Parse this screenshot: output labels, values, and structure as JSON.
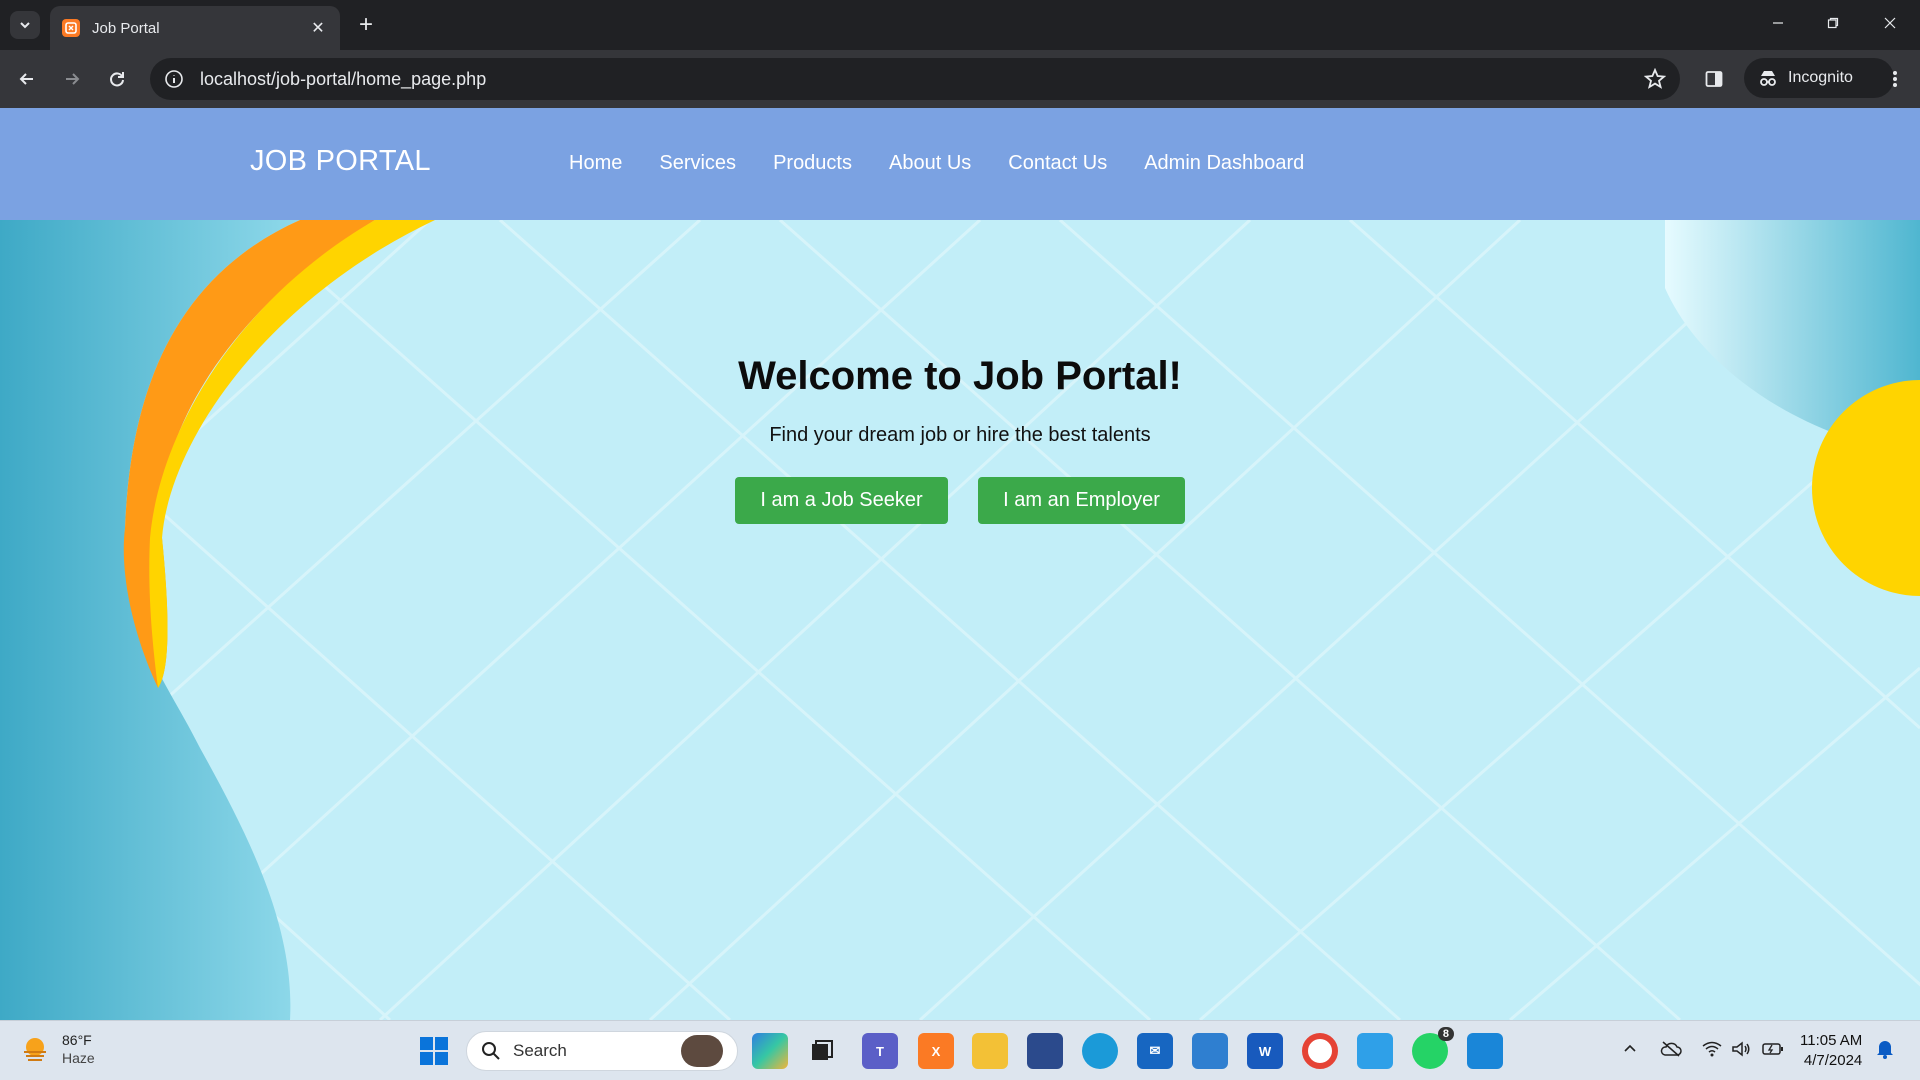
{
  "browser": {
    "tab_title": "Job Portal",
    "url": "localhost/job-portal/home_page.php",
    "incognito_label": "Incognito",
    "new_tab_symbol": "+",
    "tab_close_symbol": "✕"
  },
  "navbar": {
    "brand": "JOB PORTAL",
    "links": [
      "Home",
      "Services",
      "Products",
      "About Us",
      "Contact Us",
      "Admin Dashboard"
    ]
  },
  "hero": {
    "title": "Welcome to Job Portal!",
    "subtitle": "Find your dream job or hire the best talents",
    "seeker_button": "I am a Job Seeker",
    "employer_button": "I am an Employer"
  },
  "taskbar": {
    "weather_temp": "86°F",
    "weather_desc": "Haze",
    "search_placeholder": "Search",
    "whatsapp_badge": "8",
    "clock_time": "11:05 AM",
    "clock_date": "4/7/2024"
  },
  "colors": {
    "navbar": "#7ba2e2",
    "button": "#3ba94a",
    "hero_bg": "#c2eef8"
  }
}
